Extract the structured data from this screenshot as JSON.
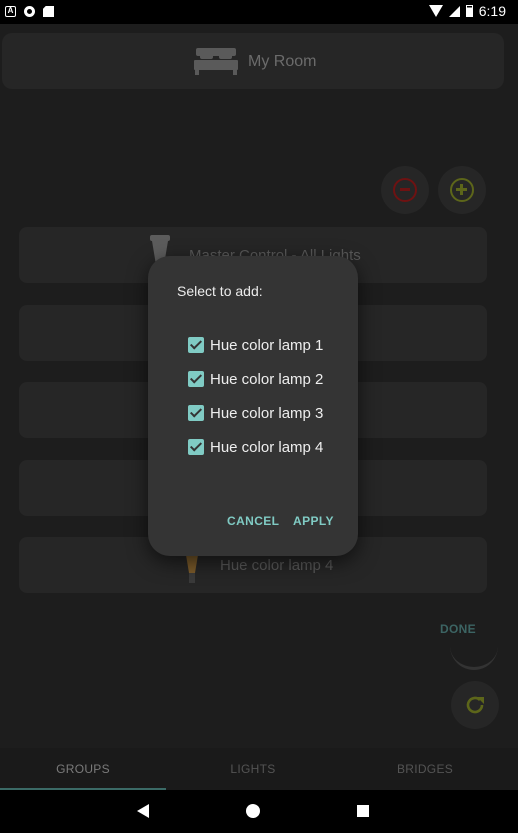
{
  "status_bar": {
    "time": "6:19",
    "icons": [
      "a-notification-icon",
      "circle-notification-icon",
      "sd-card-icon",
      "wifi-icon",
      "signal-icon",
      "battery-icon"
    ]
  },
  "room": {
    "icon": "bed-icon",
    "name": "My Room"
  },
  "actions": {
    "alarm_icon": "alarm-icon",
    "add_icon": "add-circle-icon",
    "refresh_icon": "refresh-icon"
  },
  "groups": [
    {
      "label": "Master Control - All Lights"
    },
    {
      "label": ""
    },
    {
      "label": ""
    },
    {
      "label": ""
    },
    {
      "label": "Hue color lamp 4"
    }
  ],
  "done_label": "DONE",
  "tabs": [
    {
      "label": "GROUPS",
      "active": true
    },
    {
      "label": "LIGHTS",
      "active": false
    },
    {
      "label": "BRIDGES",
      "active": false
    }
  ],
  "dialog": {
    "title": "Select to add:",
    "options": [
      {
        "label": "Hue color lamp 1",
        "checked": true
      },
      {
        "label": "Hue color lamp 2",
        "checked": true
      },
      {
        "label": "Hue color lamp 3",
        "checked": true
      },
      {
        "label": "Hue color lamp 4",
        "checked": true
      }
    ],
    "cancel_label": "CANCEL",
    "apply_label": "APPLY"
  },
  "colors": {
    "accent": "#80cbc4",
    "dialog_bg": "#343434",
    "alarm": "#6e1212",
    "add": "#5d661a"
  }
}
